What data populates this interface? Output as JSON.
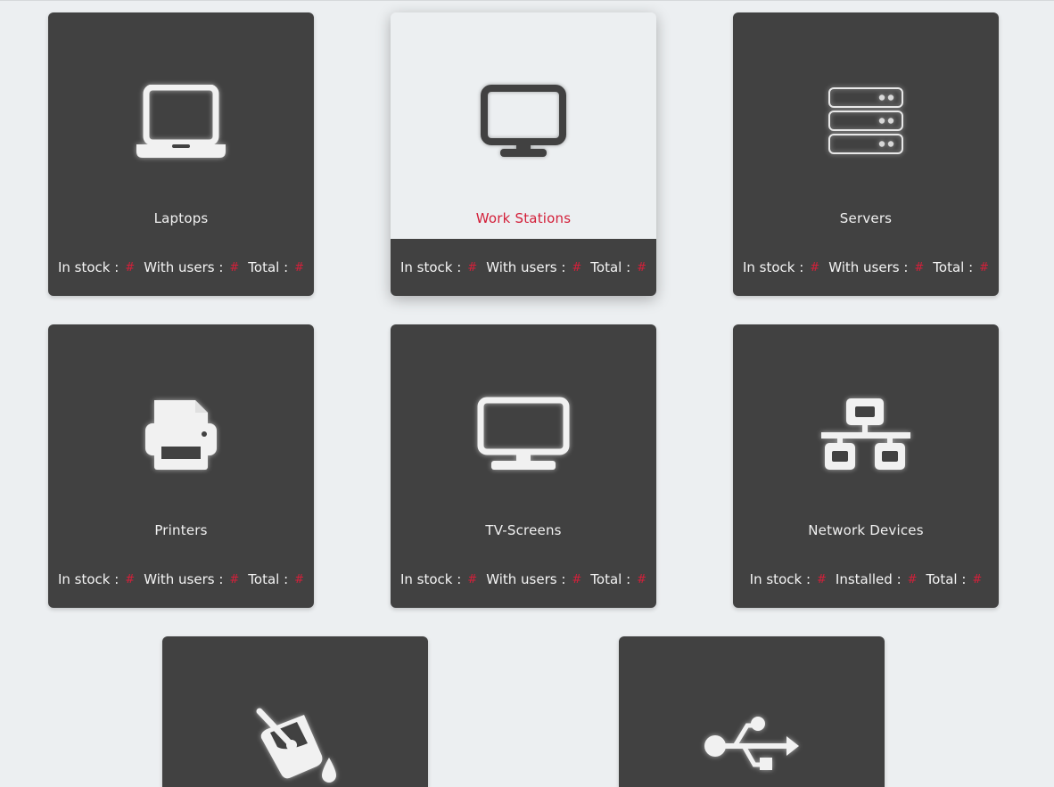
{
  "cards": [
    {
      "title": "Laptops",
      "icon": "laptop-icon",
      "active": false,
      "stats": [
        {
          "label": "In stock :",
          "value": "#"
        },
        {
          "label": "With users :",
          "value": "#"
        },
        {
          "label": "Total :",
          "value": "#"
        }
      ]
    },
    {
      "title": "Work Stations",
      "icon": "desktop-icon",
      "active": true,
      "stats": [
        {
          "label": "In stock :",
          "value": "#"
        },
        {
          "label": "With users :",
          "value": "#"
        },
        {
          "label": "Total :",
          "value": "#"
        }
      ]
    },
    {
      "title": "Servers",
      "icon": "server-icon",
      "active": false,
      "stats": [
        {
          "label": "In stock :",
          "value": "#"
        },
        {
          "label": "With users :",
          "value": "#"
        },
        {
          "label": "Total :",
          "value": "#"
        }
      ]
    },
    {
      "title": "Printers",
      "icon": "printer-icon",
      "active": false,
      "stats": [
        {
          "label": "In stock :",
          "value": "#"
        },
        {
          "label": "With users :",
          "value": "#"
        },
        {
          "label": "Total :",
          "value": "#"
        }
      ]
    },
    {
      "title": "TV-Screens",
      "icon": "tv-icon",
      "active": false,
      "stats": [
        {
          "label": "In stock :",
          "value": "#"
        },
        {
          "label": "With users :",
          "value": "#"
        },
        {
          "label": "Total :",
          "value": "#"
        }
      ]
    },
    {
      "title": "Network Devices",
      "icon": "network-icon",
      "active": false,
      "stats": [
        {
          "label": "In stock :",
          "value": "#"
        },
        {
          "label": "Installed :",
          "value": "#"
        },
        {
          "label": "Total :",
          "value": "#"
        }
      ]
    },
    {
      "icon": "paint-bucket-icon",
      "active": false
    },
    {
      "icon": "usb-icon",
      "active": false
    }
  ],
  "colors": {
    "background": "#eceff1",
    "card": "#414141",
    "accent": "#d3203a",
    "text": "#f1f1f1"
  }
}
